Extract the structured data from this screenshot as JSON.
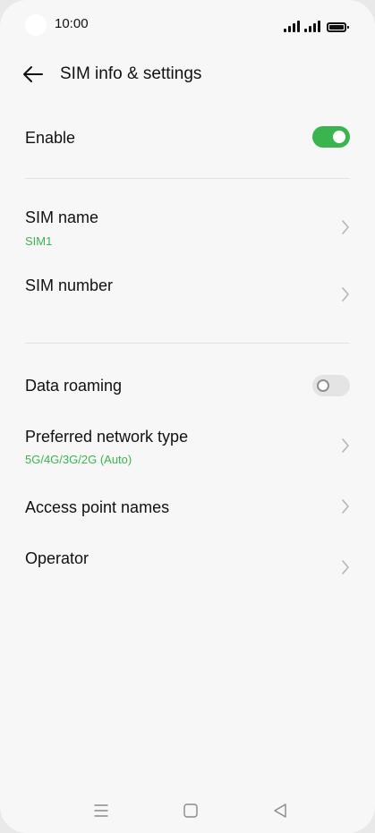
{
  "status_bar": {
    "time": "10:00"
  },
  "header": {
    "title": "SIM info & settings",
    "back_icon": "arrow-left-icon"
  },
  "settings": {
    "enable": {
      "label": "Enable",
      "toggle": "on"
    },
    "sim_name": {
      "label": "SIM name",
      "value": "SIM1"
    },
    "sim_number": {
      "label": "SIM number"
    },
    "data_roaming": {
      "label": "Data roaming",
      "toggle": "off"
    },
    "preferred_network": {
      "label": "Preferred network type",
      "value": "5G/4G/3G/2G (Auto)"
    },
    "apn": {
      "label": "Access point names"
    },
    "operator": {
      "label": "Operator"
    }
  },
  "colors": {
    "accent": "#3bb44f",
    "background": "#f7f7f7",
    "toggle_off": "#e4e4e4"
  },
  "navbar": {
    "icons": [
      "menu-icon",
      "home-square-icon",
      "back-triangle-icon"
    ]
  }
}
